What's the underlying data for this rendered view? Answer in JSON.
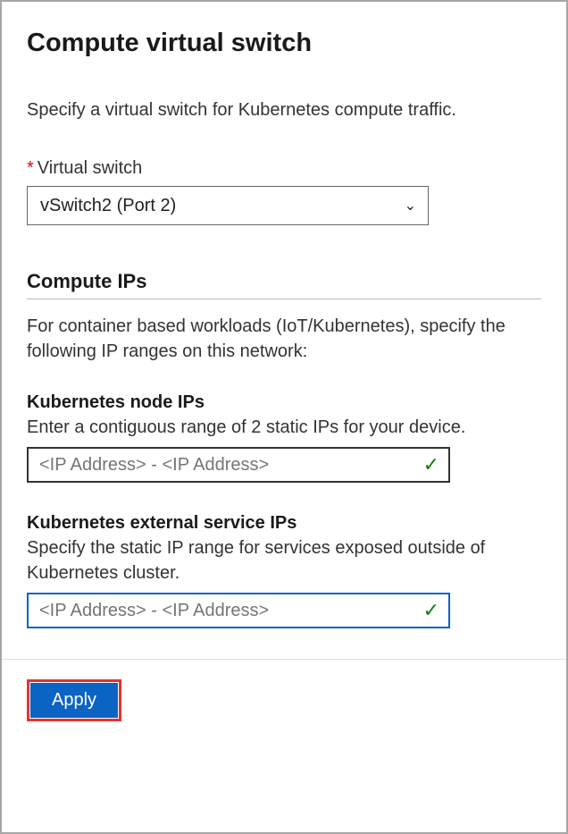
{
  "title": "Compute virtual switch",
  "subtitle": "Specify a virtual switch for Kubernetes compute traffic.",
  "virtualSwitch": {
    "label": "Virtual switch",
    "selected": "vSwitch2 (Port 2)"
  },
  "computeIPs": {
    "heading": "Compute IPs",
    "desc": "For container based workloads (IoT/Kubernetes), specify the following IP ranges on this network:"
  },
  "nodeIPs": {
    "title": "Kubernetes node IPs",
    "desc": "Enter a contiguous range of 2 static IPs for your device.",
    "placeholder": "<IP Address> - <IP Address>",
    "value": ""
  },
  "serviceIPs": {
    "title": "Kubernetes external service IPs",
    "desc": "Specify the static IP range for services exposed outside of Kubernetes cluster.",
    "placeholder": "<IP Address> - <IP Address>",
    "value": ""
  },
  "buttons": {
    "apply": "Apply"
  },
  "icons": {
    "chevron": "⌄",
    "check": "✓"
  }
}
